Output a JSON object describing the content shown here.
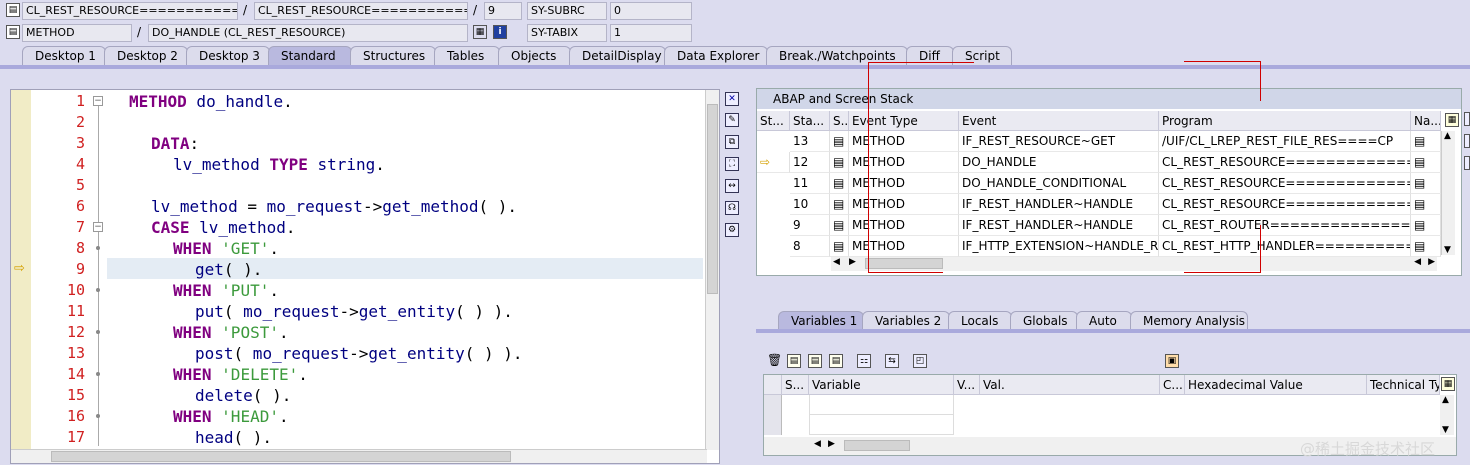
{
  "header": {
    "program_field": "CL_REST_RESOURCE===============...",
    "program_field2": "CL_REST_RESOURCE================...",
    "line_no": "9",
    "var1_name": "SY-SUBRC",
    "var1_value": "0",
    "event_type": "METHOD",
    "event_name": "DO_HANDLE (CL_REST_RESOURCE)",
    "var2_name": "SY-TABIX",
    "var2_value": "1",
    "sep": "/"
  },
  "tabs": [
    "Desktop 1",
    "Desktop 2",
    "Desktop 3",
    "Standard",
    "Structures",
    "Tables",
    "Objects",
    "DetailDisplay",
    "Data Explorer",
    "Break./Watchpoints",
    "Diff",
    "Script"
  ],
  "active_tab": "Standard",
  "editor": {
    "line_numbers": [
      "1",
      "2",
      "3",
      "4",
      "5",
      "6",
      "7",
      "8",
      "9",
      "10",
      "11",
      "12",
      "13",
      "14",
      "15",
      "16",
      "17"
    ],
    "current_line": "9"
  },
  "stack": {
    "title": "ABAP and Screen Stack",
    "columns": [
      "St...",
      "Sta...",
      "S...",
      "Event Type",
      "Event",
      "Program",
      "Na..."
    ],
    "rows": [
      {
        "st": "",
        "level": "13",
        "type": "METHOD",
        "event": "IF_REST_RESOURCE~GET",
        "program": "/UIF/CL_LREP_REST_FILE_RES====CP"
      },
      {
        "st": "arrow",
        "level": "12",
        "type": "METHOD",
        "event": "DO_HANDLE",
        "program": "CL_REST_RESOURCE================..."
      },
      {
        "st": "",
        "level": "11",
        "type": "METHOD",
        "event": "DO_HANDLE_CONDITIONAL",
        "program": "CL_REST_RESOURCE================..."
      },
      {
        "st": "",
        "level": "10",
        "type": "METHOD",
        "event": "IF_REST_HANDLER~HANDLE",
        "program": "CL_REST_RESOURCE================..."
      },
      {
        "st": "",
        "level": "9",
        "type": "METHOD",
        "event": "IF_REST_HANDLER~HANDLE",
        "program": "CL_REST_ROUTER==================..."
      },
      {
        "st": "",
        "level": "8",
        "type": "METHOD",
        "event": "IF_HTTP_EXTENSION~HANDLE_R...",
        "program": "CL_REST_HTTP_HANDLER==========C..."
      }
    ]
  },
  "variables": {
    "tabs": [
      "Variables 1",
      "Variables 2",
      "Locals",
      "Globals",
      "Auto",
      "Memory Analysis"
    ],
    "active_tab": "Variables 1",
    "columns": [
      "S...",
      "Variable",
      "V...",
      "Val.",
      "C...",
      "Hexadecimal Value",
      "Technical Ty"
    ]
  },
  "watermark": "@稀土掘金技术社区",
  "colors": {
    "keyword": "#800080",
    "string": "#3c9a3c",
    "identifier": "#000080",
    "line_number": "#d02020",
    "active_tab": "#b9b9df"
  }
}
